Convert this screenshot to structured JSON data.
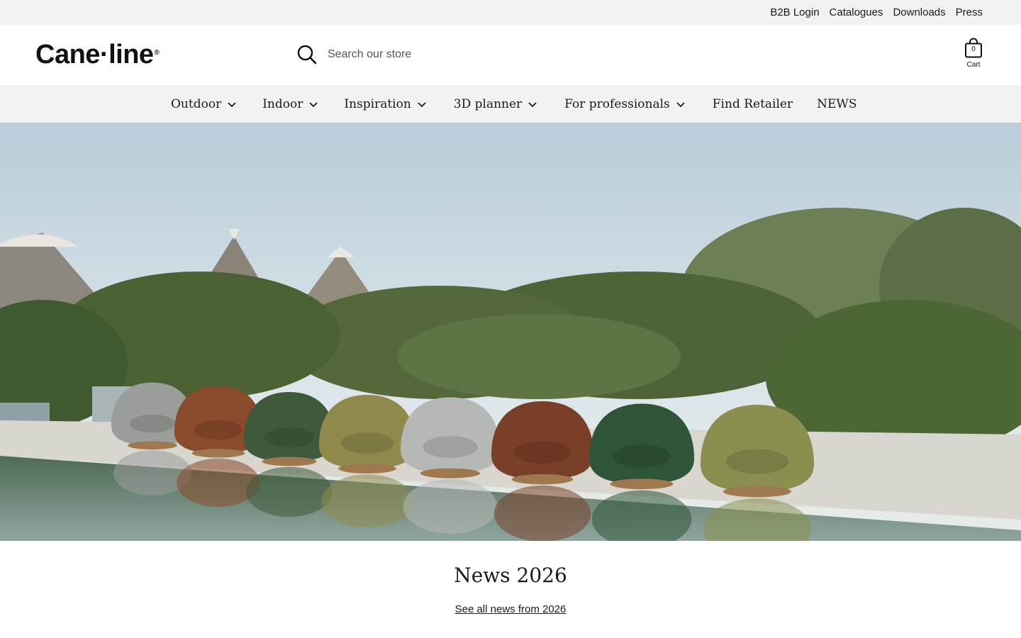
{
  "utility": {
    "links": [
      "B2B Login",
      "Catalogues",
      "Downloads",
      "Press"
    ]
  },
  "header": {
    "logo_text": "Cane·line",
    "logo_mark": "®",
    "search_placeholder": "Search our store",
    "cart_count": "0",
    "cart_label": "Cart"
  },
  "nav": {
    "items": [
      {
        "label": "Outdoor",
        "has_dropdown": true
      },
      {
        "label": "Indoor",
        "has_dropdown": true
      },
      {
        "label": "Inspiration",
        "has_dropdown": true
      },
      {
        "label": "3D planner",
        "has_dropdown": true
      },
      {
        "label": "For professionals",
        "has_dropdown": true
      },
      {
        "label": "Find Retailer",
        "has_dropdown": false
      },
      {
        "label": "NEWS",
        "has_dropdown": false
      }
    ]
  },
  "hero": {
    "chair_colors": [
      "#9a9d9a",
      "#8a4a2c",
      "#3f5a3a",
      "#8f8a4c",
      "#b6b8b6",
      "#7a3f28",
      "#2f5538",
      "#8a8f4f"
    ]
  },
  "news": {
    "title": "News 2026",
    "link_label": "See all news from 2026"
  },
  "colors": {
    "bar_bg": "#f2f2f2",
    "text": "#1a1a1a"
  }
}
